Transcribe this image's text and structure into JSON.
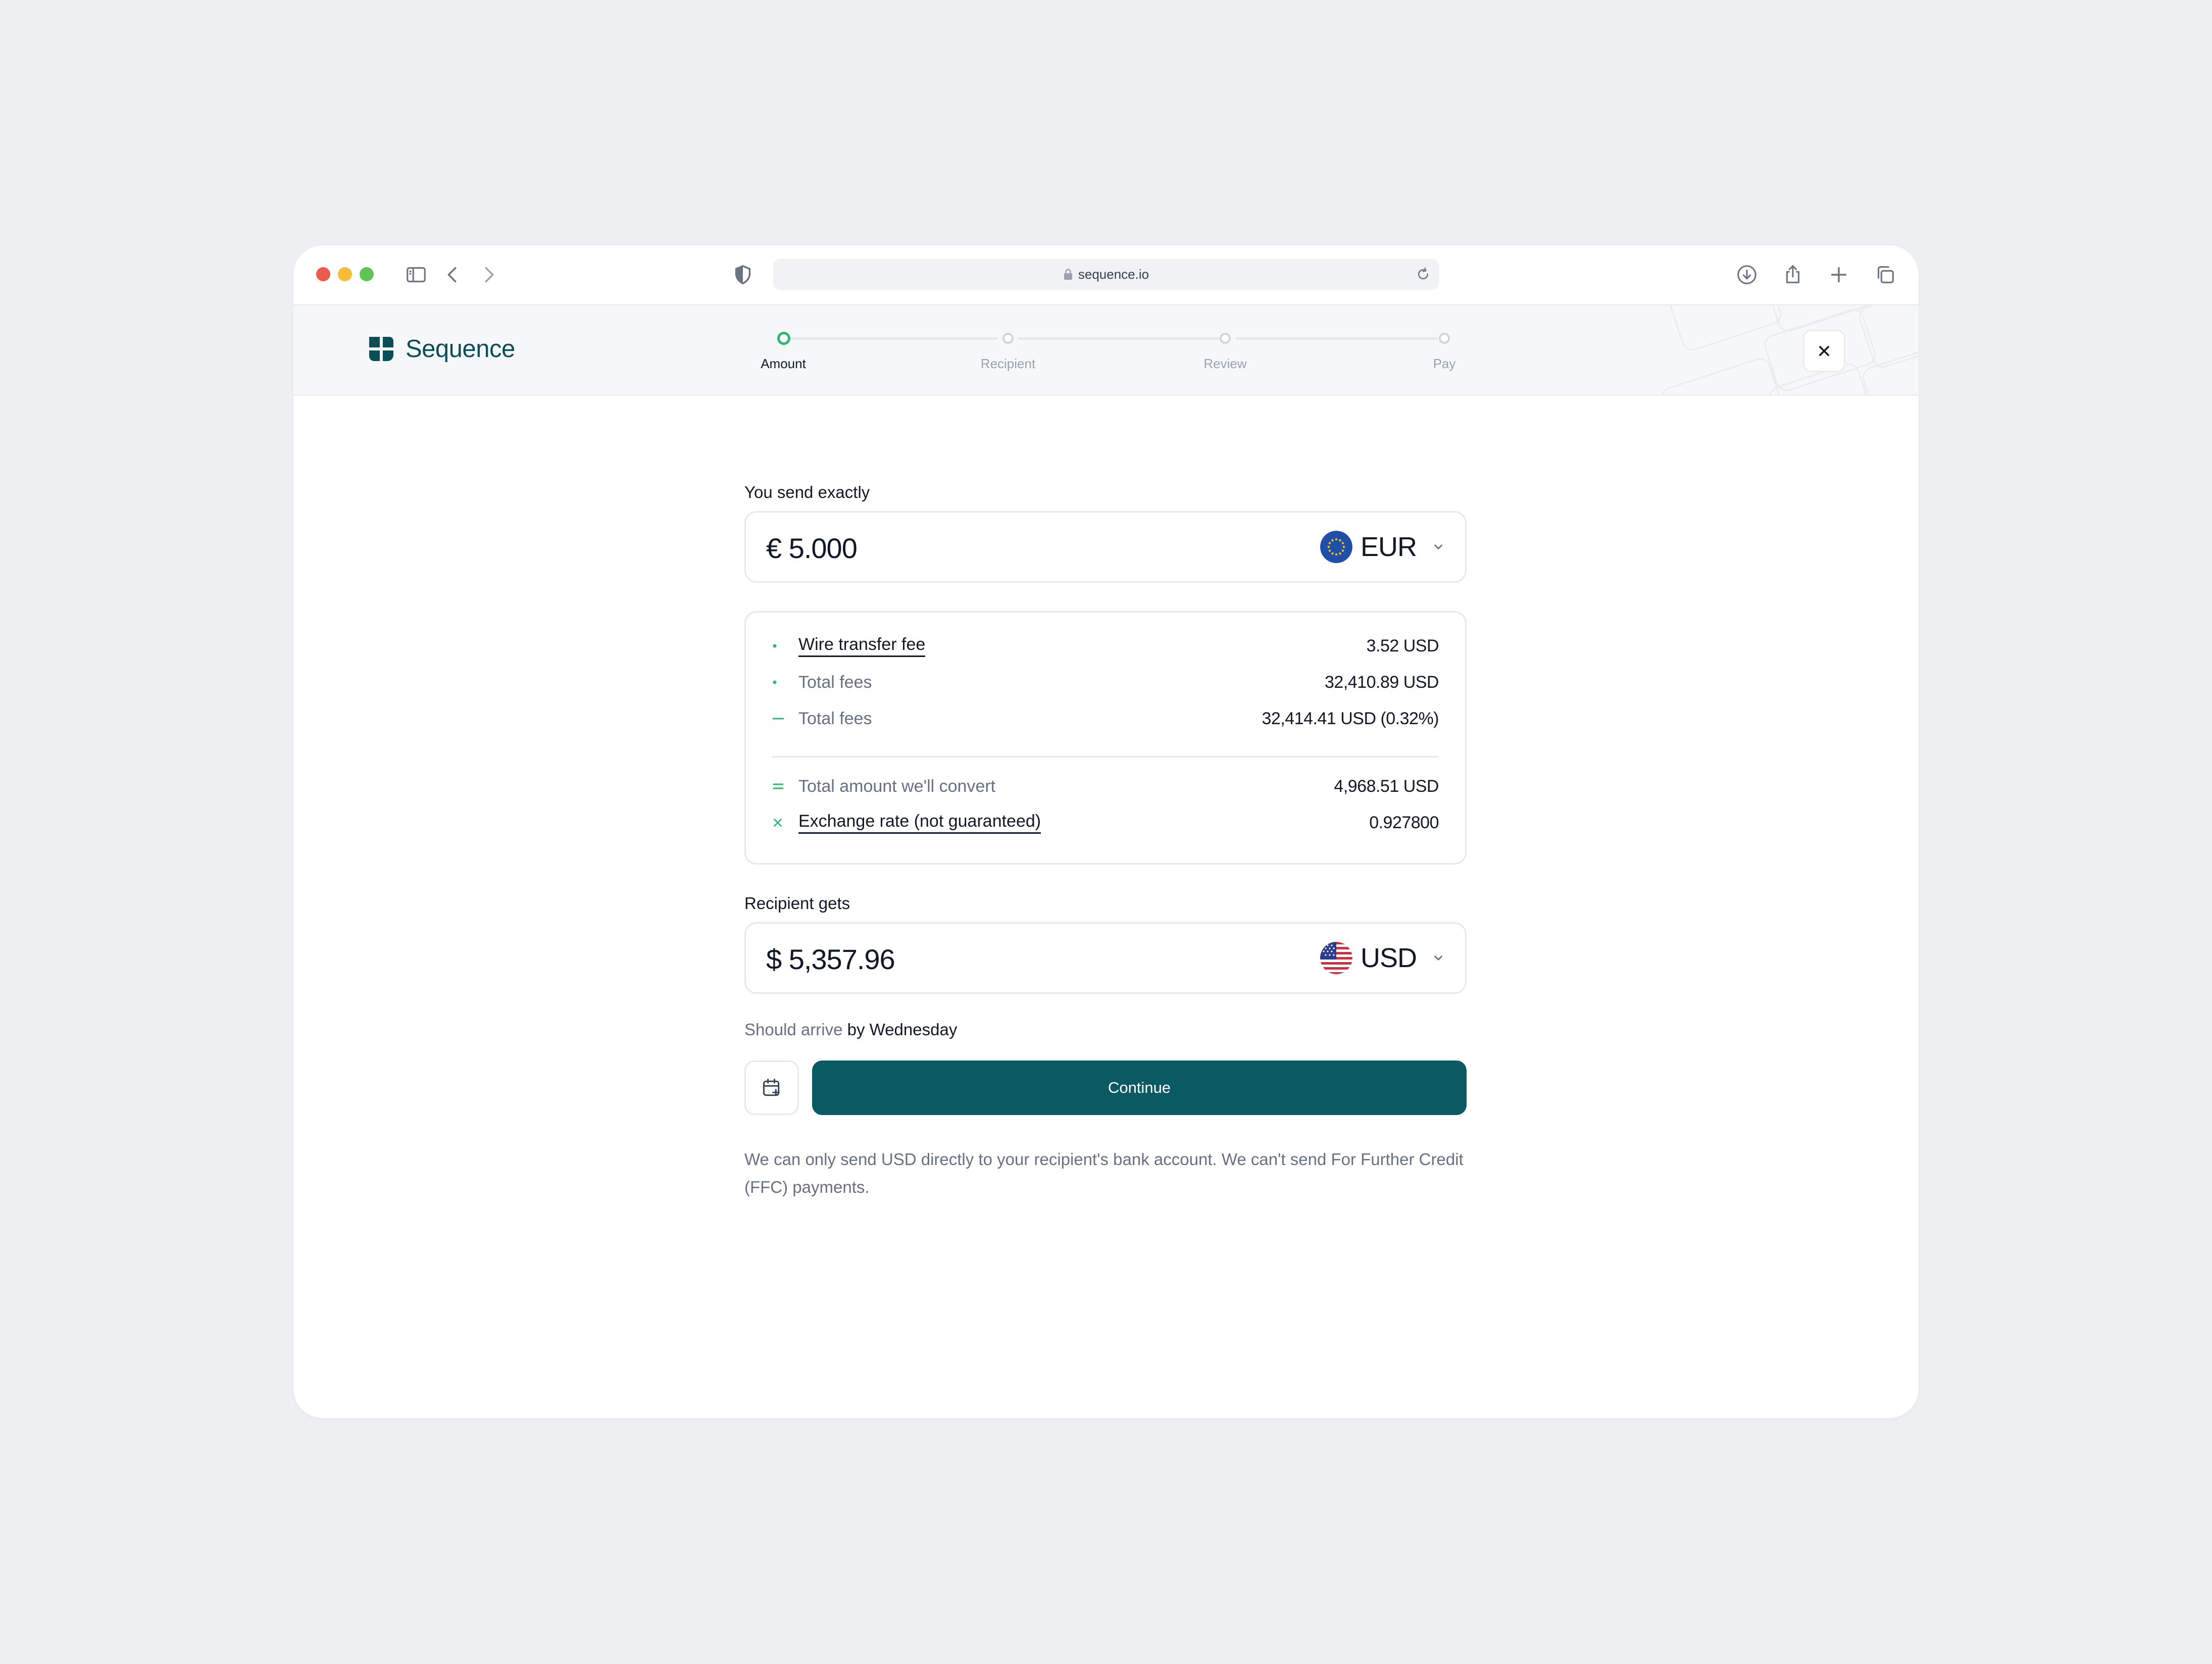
{
  "browser": {
    "url": "sequence.io"
  },
  "header": {
    "brand": "Sequence",
    "steps": [
      {
        "label": "Amount",
        "state": "active"
      },
      {
        "label": "Recipient",
        "state": "todo"
      },
      {
        "label": "Review",
        "state": "todo"
      },
      {
        "label": "Pay",
        "state": "todo"
      }
    ]
  },
  "send": {
    "label": "You send exactly",
    "amount": "€ 5.000",
    "currency": "EUR"
  },
  "breakdown": {
    "rows": [
      {
        "symbol": "dot",
        "name": "Wire transfer fee",
        "value": "3.52 USD"
      },
      {
        "symbol": "dot",
        "name": "Total fees",
        "value": "32,410.89 USD"
      },
      {
        "symbol": "minus",
        "name": "Total fees",
        "value": "32,414.41 USD (0.32%)"
      },
      {
        "symbol": "equals",
        "name": "Total amount we'll convert",
        "value": "4,968.51 USD"
      },
      {
        "symbol": "times",
        "name": "Exchange rate (not guaranteed)",
        "value": "0.927800"
      }
    ]
  },
  "receive": {
    "label": "Recipient gets",
    "amount": "$ 5,357.96",
    "currency": "USD"
  },
  "arrival": {
    "prefix": "Should arrive",
    "when": "by Wednesday"
  },
  "actions": {
    "continue_label": "Continue"
  },
  "note": "We can only send USD directly to your recipient's bank account. We can't send For Further Credit (FFC) payments.",
  "colors": {
    "accent": "#0a5a64",
    "success": "#2fb673",
    "muted_text": "#667085"
  }
}
